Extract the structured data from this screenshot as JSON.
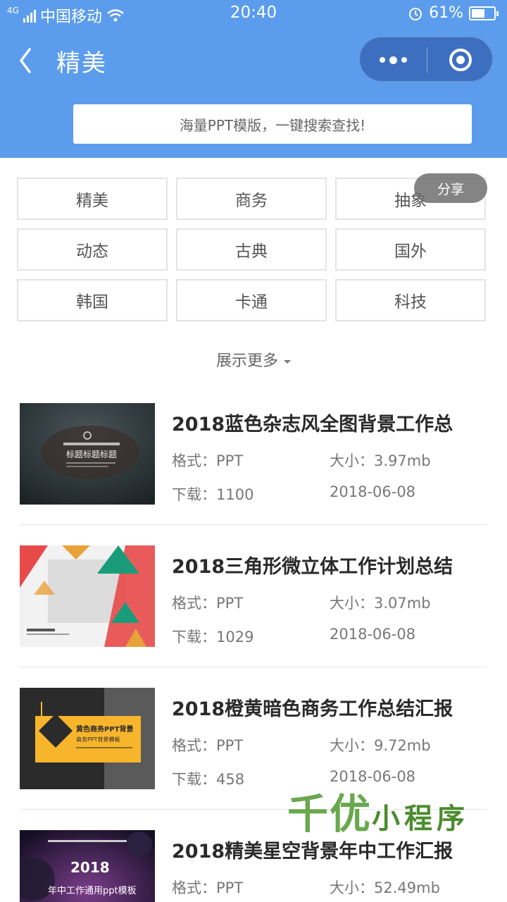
{
  "status_bar": {
    "network": "4G",
    "carrier": "中国移动",
    "time": "20:40",
    "battery_percent": "61%",
    "battery_level": 0.61
  },
  "nav": {
    "title": "精美"
  },
  "search": {
    "placeholder": "海量PPT模版，一键搜索查找!"
  },
  "categories": [
    "精美",
    "商务",
    "抽象",
    "动态",
    "古典",
    "国外",
    "韩国",
    "卡通",
    "科技"
  ],
  "share_label": "分享",
  "show_more_label": "展示更多",
  "items": [
    {
      "title": "2018蓝色杂志风全图背景工作总",
      "format": "格式：PPT",
      "size": "大小：3.97mb",
      "downloads": "下载：1100",
      "date": "2018-06-08"
    },
    {
      "title": "2018三角形微立体工作计划总结",
      "format": "格式：PPT",
      "size": "大小：3.07mb",
      "downloads": "下载：1029",
      "date": "2018-06-08"
    },
    {
      "title": "2018橙黄暗色商务工作总结汇报",
      "format": "格式：PPT",
      "size": "大小：9.72mb",
      "downloads": "下载：458",
      "date": "2018-06-08"
    },
    {
      "title": "2018精美星空背景年中工作汇报",
      "format": "格式：PPT",
      "size": "大小：52.49mb",
      "downloads": "",
      "date": ""
    }
  ],
  "thumb_text": {
    "t1": "标题标题标题",
    "t3_main": "黄色商务PPT背景",
    "t3_sub": "商务PPT背景模板",
    "t4_year": "2018",
    "t4_sub": "年中工作通用ppt模板"
  },
  "watermark": {
    "big": "千优",
    "small": "小程序"
  },
  "colors": {
    "header": "#5b9cec",
    "capsule": "#3d6fc0",
    "watermark": "#6aa84f"
  }
}
